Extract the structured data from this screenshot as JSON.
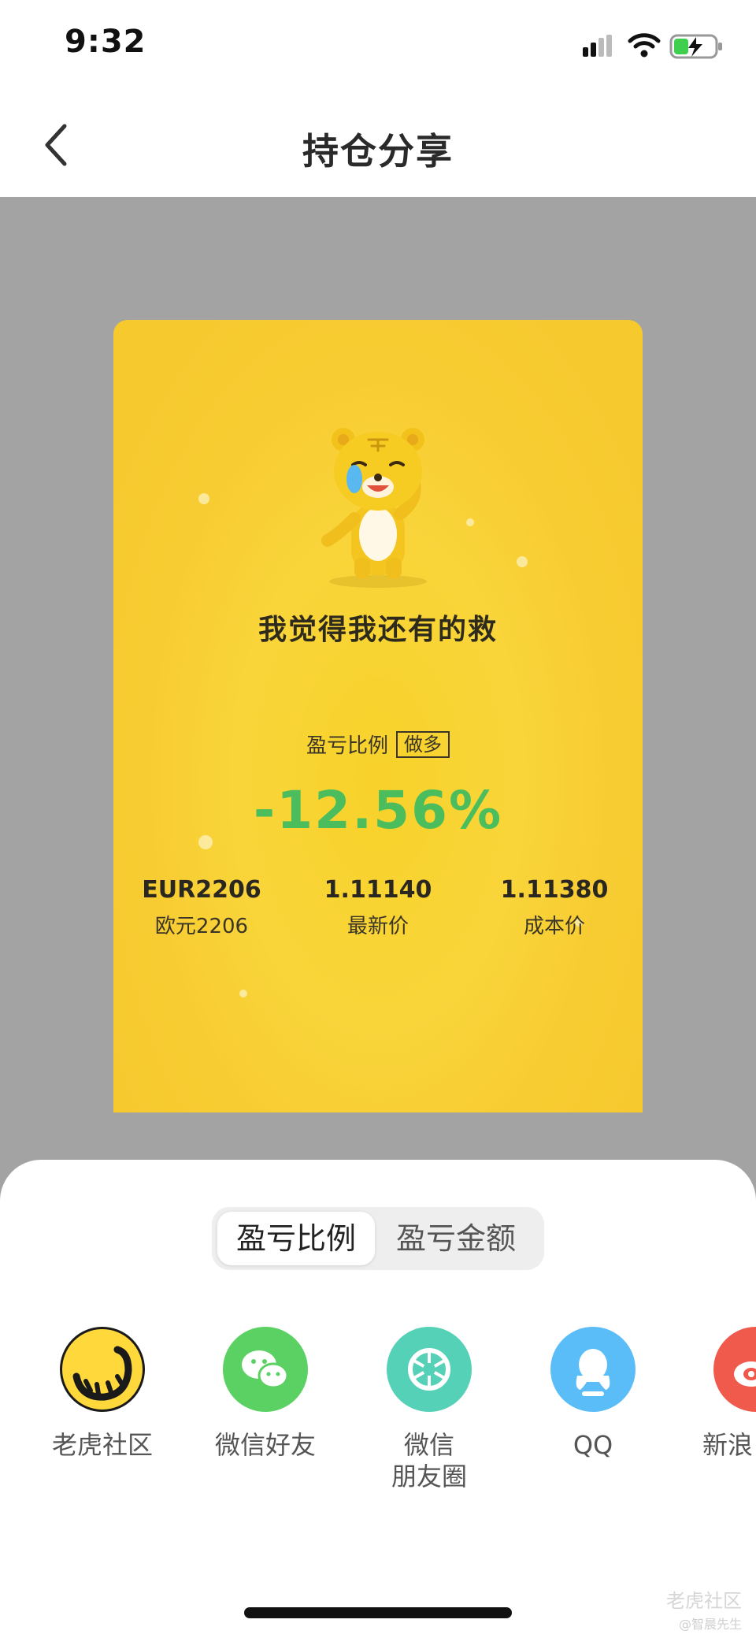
{
  "status_bar": {
    "time": "9:32"
  },
  "nav": {
    "title": "持仓分享"
  },
  "card": {
    "slogan": "我觉得我还有的救",
    "ratio_label": "盈亏比例",
    "direction_tag": "做多",
    "percent": "-12.56%",
    "stats": [
      {
        "value": "EUR2206",
        "label": "欧元2206"
      },
      {
        "value": "1.11140",
        "label": "最新价"
      },
      {
        "value": "1.11380",
        "label": "成本价"
      }
    ]
  },
  "toggle": {
    "options": [
      "盈亏比例",
      "盈亏金额"
    ],
    "selected": "盈亏比例"
  },
  "share_targets": [
    {
      "label": "老虎社区",
      "icon": "tiger-community-icon",
      "color": "#ffd93b"
    },
    {
      "label": "微信好友",
      "icon": "wechat-icon",
      "color": "#5ad162"
    },
    {
      "label_line1": "微信",
      "label_line2": "朋友圈",
      "icon": "wechat-moments-icon",
      "color": "#55d1b7"
    },
    {
      "label": "QQ",
      "icon": "qq-icon",
      "color": "#5bbdf8"
    },
    {
      "label": "新浪",
      "icon": "weibo-icon",
      "color": "#f05a4d"
    }
  ],
  "watermark": {
    "brand": "老虎社区",
    "author": "@智晨先生"
  },
  "colors": {
    "accent_yellow": "#f8d22a",
    "profit_green": "#4cbd5c"
  }
}
